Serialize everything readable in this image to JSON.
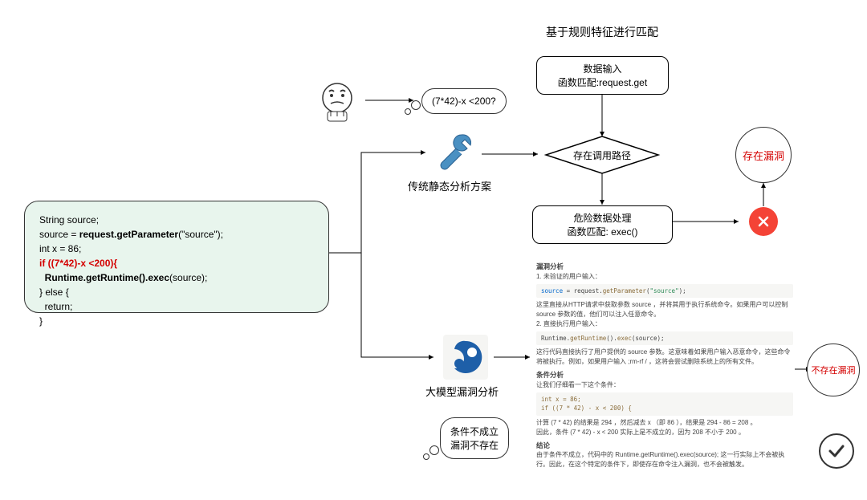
{
  "title": "基于规则特征进行匹配",
  "code": {
    "l1": "String source;",
    "l2a": "source = ",
    "l2b": "request.getParameter",
    "l2c": "(\"source\");",
    "l3": "int x = 86;",
    "l4": "if ((7*42)-x <200){",
    "l5a": "  Runtime.getRuntime().exec",
    "l5b": "(source);",
    "l6": "} else {",
    "l7": "  return;",
    "l8": "}"
  },
  "cloud_q": "(7*42)-x <200?",
  "cloud_cond": {
    "l1": "条件不成立",
    "l2": "漏洞不存在"
  },
  "flow": {
    "data_in_l1": "数据输入",
    "data_in_l2": "函数匹配:request.get",
    "path": "存在调用路径",
    "danger_l1": "危险数据处理",
    "danger_l2": "函数匹配: exec()"
  },
  "labels": {
    "static": "传统静态分析方案",
    "llm": "大模型漏洞分析"
  },
  "circles": {
    "vuln": "存在漏洞",
    "novuln": "不存在漏洞"
  },
  "analysis": {
    "h1": "漏洞分析",
    "s1": "1. 未验证的用户输入：",
    "c1": "source = request.getParameter(\"source\");",
    "t1": "这里直接从HTTP请求中获取参数 source ，并将其用于执行系统命令。如果用户可以控制 source 参数的值，他们可以注入任意命令。",
    "s2": "2. 直接执行用户输入：",
    "c2": "Runtime.getRuntime().exec(source);",
    "t2": "这行代码直接执行了用户提供的 source 参数。这意味着如果用户输入恶意命令，这些命令将被执行。例如，如果用户输入 ;rm-rf / ，这将会尝试删除系统上的所有文件。",
    "h2": "条件分析",
    "t3": "让我们仔细看一下这个条件：",
    "c3a": "int x = 86;",
    "c3b": "if ((7 * 42) - x < 200) {",
    "t4": "计算 (7 * 42) 的结果是 294 ，然后减去 x （即 86 ），结果是 294 - 86 = 208 。",
    "t5": "因此，条件 (7 * 42) - x < 200 实际上是不成立的，因为 208 不小于 200 。",
    "h3": "结论",
    "t6": "由于条件不成立，代码中的 Runtime.getRuntime().exec(source); 这一行实际上不会被执行。因此，在这个特定的条件下，即使存在命令注入漏洞，也不会被触发。"
  }
}
